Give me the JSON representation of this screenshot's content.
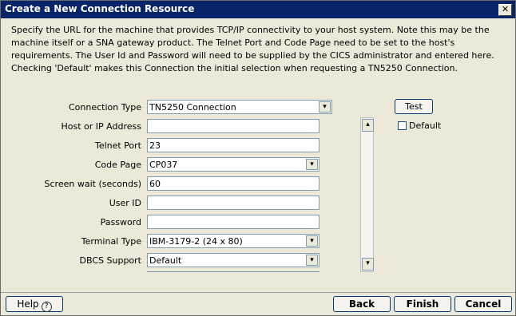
{
  "window": {
    "title": "Create a New Connection Resource",
    "close_glyph": "✕"
  },
  "description": "Specify the URL for the machine that provides TCP/IP connectivity to your host system.  Note this may be the machine itself or a SNA gateway product. The Telnet Port and Code Page need to be set to the host's requirements. The User Id and Password will need to be supplied by the CICS administrator and entered here. Checking 'Default' makes this Connection the initial selection when requesting a TN5250 Connection.",
  "form": {
    "connection_type": {
      "label": "Connection Type",
      "value": "TN5250 Connection"
    },
    "host": {
      "label": "Host or IP Address",
      "value": ""
    },
    "telnet_port": {
      "label": "Telnet Port",
      "value": "23"
    },
    "code_page": {
      "label": "Code Page",
      "value": "CP037"
    },
    "screen_wait": {
      "label": "Screen wait (seconds)",
      "value": "60"
    },
    "user_id": {
      "label": "User ID",
      "value": ""
    },
    "password": {
      "label": "Password",
      "value": ""
    },
    "terminal_type": {
      "label": "Terminal Type",
      "value": "IBM-3179-2 (24 x 80)"
    },
    "dbcs_support": {
      "label": "DBCS Support",
      "value": "Default"
    }
  },
  "side": {
    "test_label": "Test",
    "default_label": "Default",
    "default_checked": false
  },
  "footer": {
    "help": "Help",
    "help_glyph": "?",
    "back": "Back",
    "finish": "Finish",
    "cancel": "Cancel"
  },
  "icons": {
    "dropdown": "chevron-down-icon",
    "scroll_up": "chevron-up-icon",
    "scroll_down": "chevron-down-icon"
  }
}
